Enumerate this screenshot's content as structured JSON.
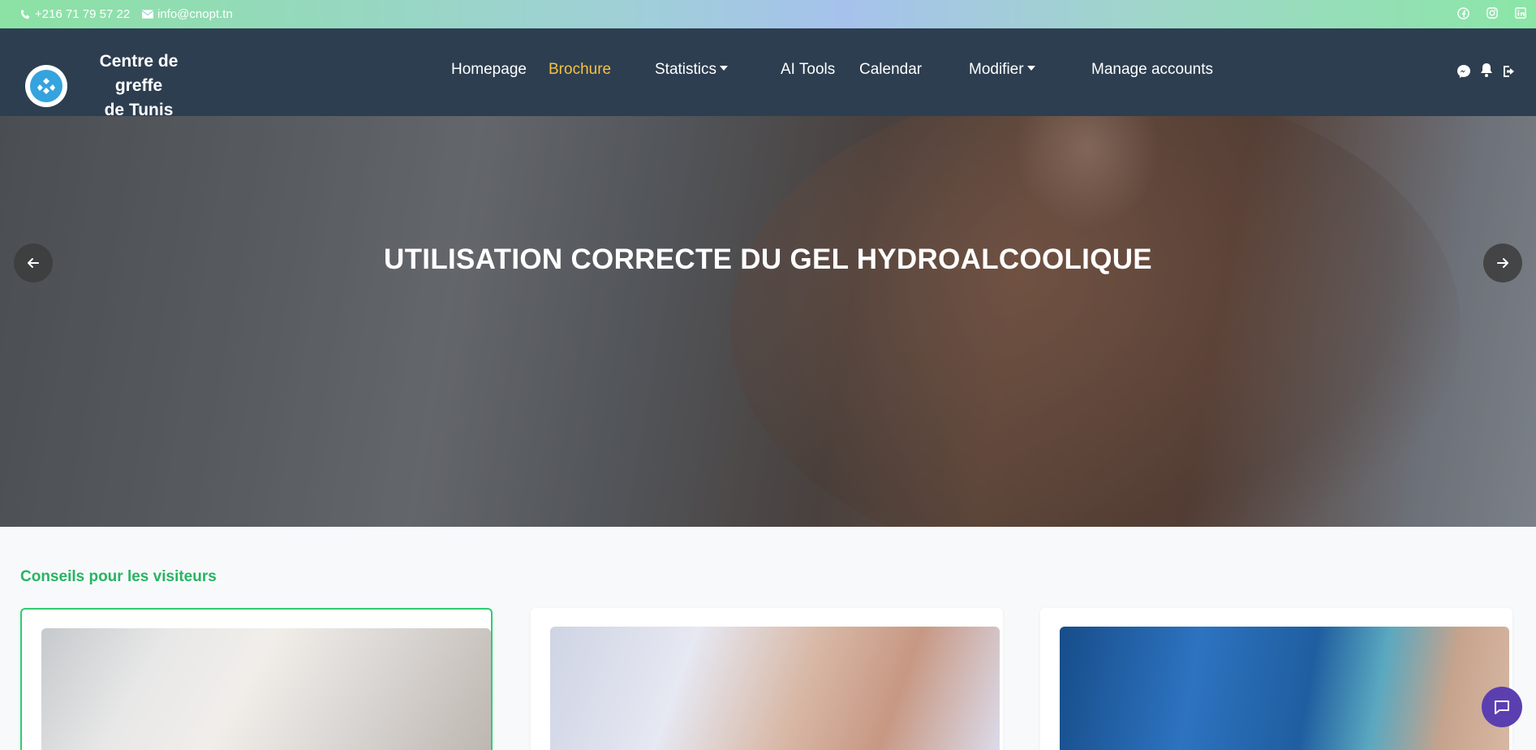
{
  "topbar": {
    "phone": "+216 71 79 57 22",
    "email": "info@cnopt.tn",
    "social": [
      "facebook-icon",
      "instagram-icon",
      "linkedin-icon"
    ]
  },
  "brand": {
    "line1": "Centre de greffe",
    "line2": "de Tunis"
  },
  "nav": {
    "homepage": "Homepage",
    "brochure": "Brochure",
    "statistics": "Statistics",
    "ai_tools": "AI Tools",
    "calendar": "Calendar",
    "modifier": "Modifier",
    "manage_accounts": "Manage accounts",
    "active_color": "#f5c242"
  },
  "hero": {
    "title": "UTILISATION CORRECTE DU GEL HYDROALCOOLIQUE"
  },
  "section": {
    "title": "Conseils pour les visiteurs"
  },
  "colors": {
    "navbar": "#2d3e50",
    "accent_green": "#28b463",
    "chat": "#5b3fb0"
  }
}
